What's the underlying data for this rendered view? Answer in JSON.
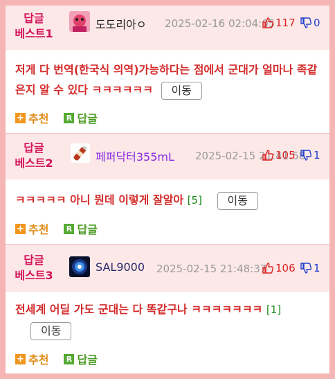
{
  "comments": [
    {
      "rank_line1": "답글",
      "rank_line2": "베스트1",
      "nickname": "도도리아ㅇ",
      "nick_color": "#222222",
      "date": "2025-02-16 02:04:05",
      "likes": "117",
      "dislikes": "0",
      "text": "저게 다 번역(한국식 의역)가능하다는 점에서 군대가 얼마나 족같은지 알 수 있다 ㅋㅋㅋㅋㅋㅋ",
      "reply_count": "",
      "move_label": "이동",
      "recommend_label": "추천",
      "reply_label": "답글"
    },
    {
      "rank_line1": "답글",
      "rank_line2": "베스트2",
      "nickname": "페퍼닥터355mL",
      "nick_color": "#8a2be2",
      "date": "2025-02-15 21:41:58",
      "likes": "105",
      "dislikes": "1",
      "text": "ㅋㅋㅋㅋㅋ 아니 뭔데 이렇게 잘알아",
      "reply_count": "[5]",
      "move_label": "이동",
      "recommend_label": "추천",
      "reply_label": "답글"
    },
    {
      "rank_line1": "답글",
      "rank_line2": "베스트3",
      "nickname": "SAL9000",
      "nick_color": "#2a2a6a",
      "date": "2025-02-15 21:48:37",
      "likes": "106",
      "dislikes": "1",
      "text": "전세계 어딜 가도 군대는 다 똑같구나 ㅋㅋㅋㅋㅋㅋㅋ",
      "reply_count": "[1]",
      "move_label": "이동",
      "recommend_label": "추천",
      "reply_label": "답글"
    }
  ],
  "icons": {
    "recommend": "plus-icon",
    "reply": "reply-r-icon",
    "like": "thumbs-up-icon",
    "dislike": "thumbs-down-icon"
  },
  "colors": {
    "rank": "#d4145a",
    "text": "#d42b2b",
    "likes": "#dd2222",
    "dislikes": "#1d3fcc",
    "recommend": "#e08a14",
    "reply": "#4a9a22",
    "header_bg": "#fde8e8",
    "border": "#f5b5b5"
  },
  "icon_glyphs": {
    "plus": "+",
    "r": "R"
  }
}
